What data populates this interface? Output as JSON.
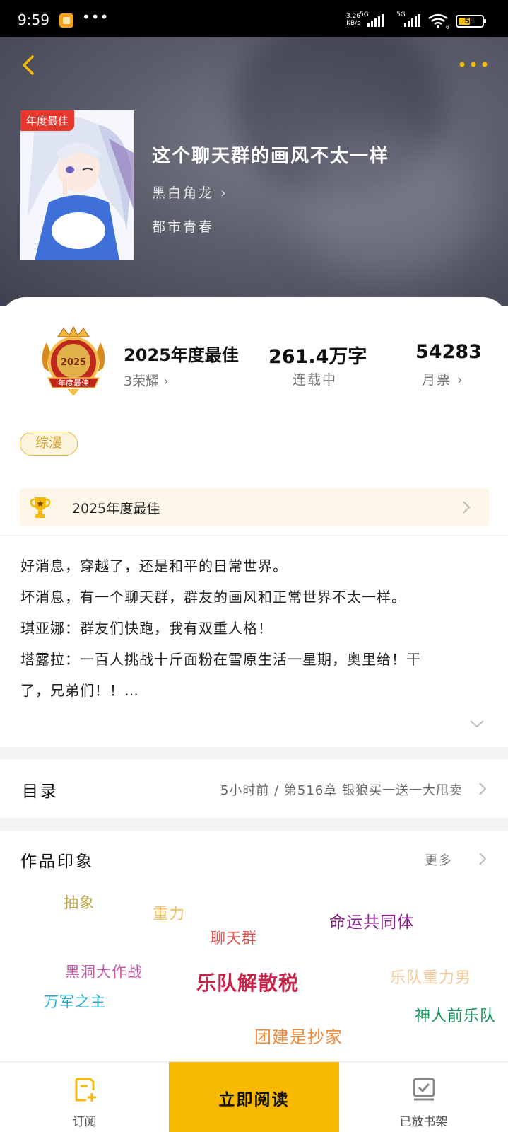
{
  "status_bar": {
    "time": "9:59",
    "more": "•••",
    "net_speed": "3.26",
    "net_unit": "KB/s",
    "sig1_label": "5G",
    "sig2_label": "5G",
    "wifi_sub": "6",
    "battery": "55"
  },
  "header": {
    "cover_badge": "年度最佳",
    "title": "这个聊天群的画风不太一样",
    "author": "黑白角龙 ›",
    "genre": "都市青春"
  },
  "stats": {
    "award_title": "2025年度最佳",
    "honors": "3荣耀 ›",
    "word_count": "261.4万字",
    "status": "连载中",
    "monthly_votes": "54283",
    "votes_label": "月票 ›",
    "medal_year": "2025",
    "medal_label": "年度最佳"
  },
  "tag": "综漫",
  "award_banner": "2025年度最佳",
  "synopsis": [
    "好消息，穿越了，还是和平的日常世界。",
    "坏消息，有一个聊天群，群友的画风和正常世界不太一样。",
    "琪亚娜：群友们快跑，我有双重人格！",
    "塔露拉：一百人挑战十斤面粉在雪原生活一星期，奥里给！干",
    "了，兄弟们！！…"
  ],
  "toc": {
    "title": "目录",
    "latest": "5小时前 / 第516章 银狼买一送一大甩卖"
  },
  "impressions": {
    "title": "作品印象",
    "more": "更多",
    "words": [
      {
        "text": "抽象",
        "color": "#b8a24a"
      },
      {
        "text": "重力",
        "color": "#f0c060"
      },
      {
        "text": "聊天群",
        "color": "#e0504a"
      },
      {
        "text": "命运共同体",
        "color": "#8a1f8a"
      },
      {
        "text": "黑洞大作战",
        "color": "#c659a8"
      },
      {
        "text": "乐队解散税",
        "color": "#c8244a"
      },
      {
        "text": "乐队重力男",
        "color": "#f5c89a"
      },
      {
        "text": "万军之主",
        "color": "#25a7c8"
      },
      {
        "text": "神人前乐队",
        "color": "#16965a"
      },
      {
        "text": "团建是抄家",
        "color": "#f08a3a"
      }
    ]
  },
  "bottom_nav": {
    "subscribe": "订阅",
    "read_now": "立即阅读",
    "on_shelf": "已放书架"
  },
  "colors": {
    "accent": "#f7b800",
    "icon_yellow": "#f5b90a",
    "badge_red": "#e8372d"
  }
}
